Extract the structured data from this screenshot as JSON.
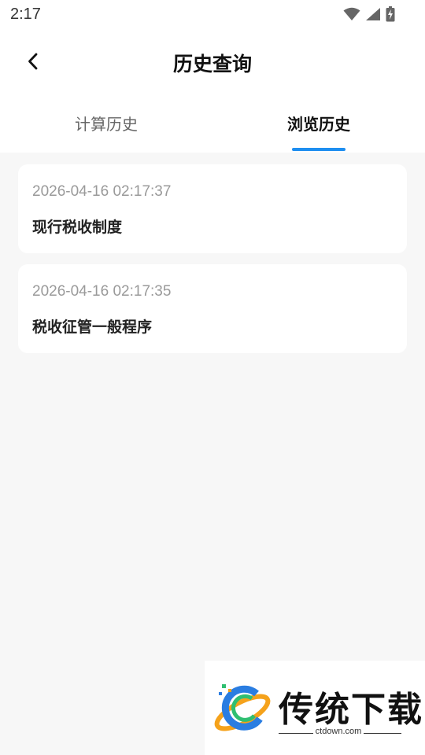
{
  "status_bar": {
    "time": "2:17",
    "icons": [
      "wifi-icon",
      "cellular-signal-icon",
      "battery-charging-icon"
    ]
  },
  "header": {
    "back_icon": "chevron-left-icon",
    "title": "历史查询"
  },
  "tabs": [
    {
      "label": "计算历史",
      "active": false
    },
    {
      "label": "浏览历史",
      "active": true
    }
  ],
  "colors": {
    "accent": "#1e8ef0",
    "background": "#f7f7f7",
    "card": "#ffffff",
    "timestamp": "#9a9a9a"
  },
  "history_items": [
    {
      "time": "2026-04-16 02:17:37",
      "title": "现行税收制度"
    },
    {
      "time": "2026-04-16 02:17:35",
      "title": "税收征管一般程序"
    }
  ],
  "watermark": {
    "brand": "传统下载",
    "url": "ctdown.com"
  }
}
